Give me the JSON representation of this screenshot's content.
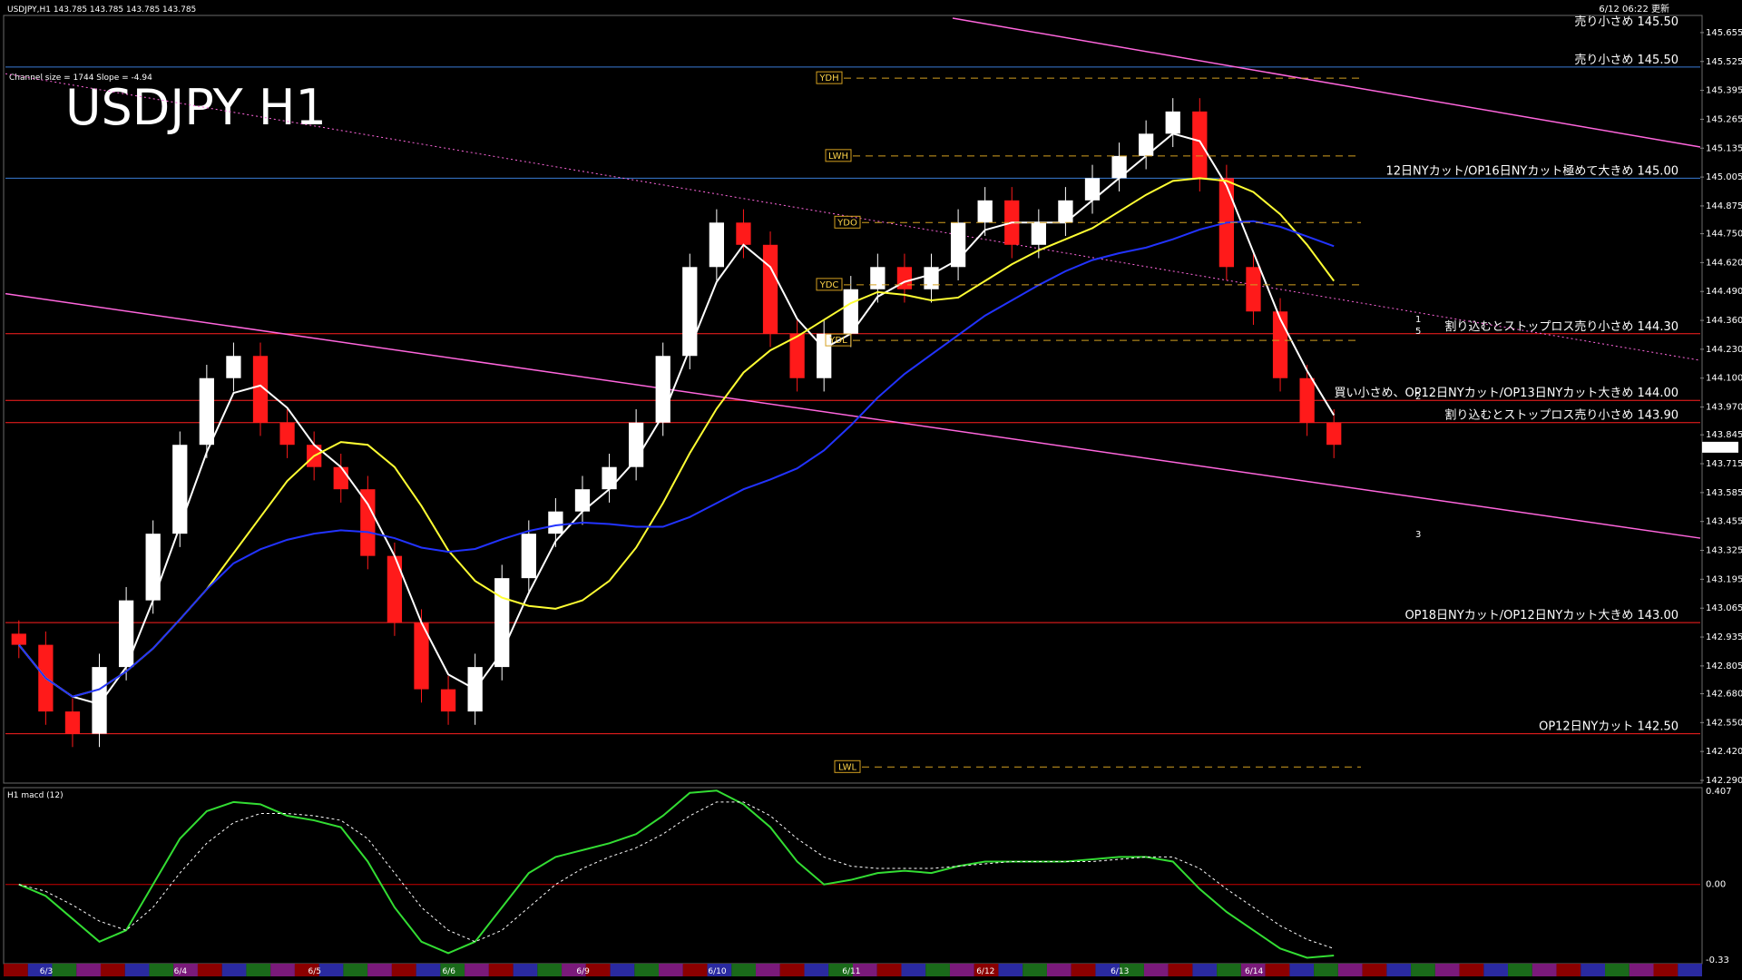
{
  "header": {
    "symbol_line": "USDJPY,H1  143.785 143.785 143.785 143.785",
    "channel_info": "Channel size = 1744 Slope = -4.94",
    "big_title": "USDJPY H1",
    "timestamp": "6/12 06:22 更新",
    "top_note": "売り小さめ 145.50"
  },
  "colors": {
    "background": "#000000",
    "bull": "#ffffff",
    "bear": "#ff1a1a",
    "ma_fast": "#ffffff",
    "ma_mid": "#ffff33",
    "ma_slow": "#2233ff",
    "channel": "#ff66dd",
    "bollinger": "#cc0000",
    "chikou": "#22bb22",
    "order_line_red": "#ff2020",
    "order_line_blue": "#3a7bd5"
  },
  "chart_data": {
    "type": "candlestick",
    "symbol": "USDJPY",
    "timeframe": "H1",
    "ylim": [
      142.29,
      145.72
    ],
    "y_ticks": [
      "145.655",
      "145.525",
      "145.395",
      "145.265",
      "145.135",
      "145.005",
      "144.875",
      "144.750",
      "144.620",
      "144.490",
      "144.360",
      "144.230",
      "144.100",
      "143.970",
      "143.845",
      "143.715",
      "143.585",
      "143.455",
      "143.325",
      "143.195",
      "143.065",
      "142.935",
      "142.805",
      "142.680",
      "142.550",
      "142.420",
      "142.290"
    ],
    "current_price": "143.785",
    "x_labels": [
      "6/3",
      "6/4",
      "6/5",
      "6/6",
      "6/9",
      "6/10",
      "6/11",
      "6/12",
      "6/13",
      "6/14"
    ],
    "closes": [
      142.9,
      142.6,
      142.5,
      142.8,
      143.1,
      143.4,
      143.8,
      144.1,
      144.2,
      143.9,
      143.8,
      143.7,
      143.6,
      143.3,
      143.0,
      142.7,
      142.6,
      142.8,
      143.2,
      143.4,
      143.5,
      143.6,
      143.7,
      143.9,
      144.2,
      144.6,
      144.8,
      144.7,
      144.3,
      144.1,
      144.3,
      144.5,
      144.6,
      144.5,
      144.6,
      144.8,
      144.9,
      144.7,
      144.8,
      144.9,
      145.0,
      145.1,
      145.2,
      145.3,
      145.0,
      144.6,
      144.4,
      144.1,
      143.9,
      143.8
    ],
    "levels": [
      {
        "label": "売り小さめ 145.50",
        "price": 145.5,
        "color": "#3a7bd5"
      },
      {
        "label": "12日NYカット/OP16日NYカット極めて大きめ 145.00",
        "price": 145.0,
        "color": "#3a7bd5"
      },
      {
        "label": "割り込むとストップロス売り小さめ 144.30",
        "price": 144.3,
        "color": "#ff2020"
      },
      {
        "label": "買い小さめ、OP12日NYカット/OP13日NYカット大きめ 144.00",
        "price": 144.0,
        "color": "#ff2020"
      },
      {
        "label": "割り込むとストップロス売り小さめ 143.90",
        "price": 143.9,
        "color": "#ff2020"
      },
      {
        "label": "OP18日NYカット/OP12日NYカット大きめ 143.00",
        "price": 143.0,
        "color": "#ff2020"
      },
      {
        "label": "OP12日NYカット 142.50",
        "price": 142.5,
        "color": "#ff2020"
      }
    ],
    "markers": [
      {
        "label": "YDH",
        "price": 145.45
      },
      {
        "label": "LWH",
        "price": 145.1
      },
      {
        "label": "YDO",
        "price": 144.8
      },
      {
        "label": "YDC",
        "price": 144.52
      },
      {
        "label": "YDL",
        "price": 144.27
      },
      {
        "label": "LWL",
        "price": 142.35
      }
    ],
    "right_labels": [
      "1",
      "5",
      "2",
      "3"
    ],
    "sub": {
      "title": "H1 macd (12)",
      "y_ticks": [
        "0.407",
        "0.00",
        "-0.33"
      ],
      "macd": [
        0.0,
        -0.05,
        -0.15,
        -0.25,
        -0.2,
        0.0,
        0.2,
        0.32,
        0.36,
        0.35,
        0.3,
        0.28,
        0.25,
        0.1,
        -0.1,
        -0.25,
        -0.3,
        -0.25,
        -0.1,
        0.05,
        0.12,
        0.15,
        0.18,
        0.22,
        0.3,
        0.4,
        0.41,
        0.35,
        0.25,
        0.1,
        0.0,
        0.02,
        0.05,
        0.06,
        0.05,
        0.08,
        0.1,
        0.1,
        0.1,
        0.1,
        0.11,
        0.12,
        0.12,
        0.1,
        -0.02,
        -0.12,
        -0.2,
        -0.28,
        -0.32,
        -0.31
      ],
      "signal": [
        0.0,
        -0.03,
        -0.09,
        -0.16,
        -0.2,
        -0.1,
        0.05,
        0.18,
        0.27,
        0.31,
        0.31,
        0.3,
        0.28,
        0.2,
        0.05,
        -0.1,
        -0.2,
        -0.25,
        -0.2,
        -0.1,
        0.0,
        0.07,
        0.12,
        0.16,
        0.22,
        0.3,
        0.36,
        0.36,
        0.3,
        0.2,
        0.12,
        0.08,
        0.07,
        0.07,
        0.07,
        0.08,
        0.09,
        0.1,
        0.1,
        0.1,
        0.1,
        0.11,
        0.12,
        0.12,
        0.07,
        -0.02,
        -0.1,
        -0.18,
        -0.24,
        -0.28
      ]
    }
  }
}
